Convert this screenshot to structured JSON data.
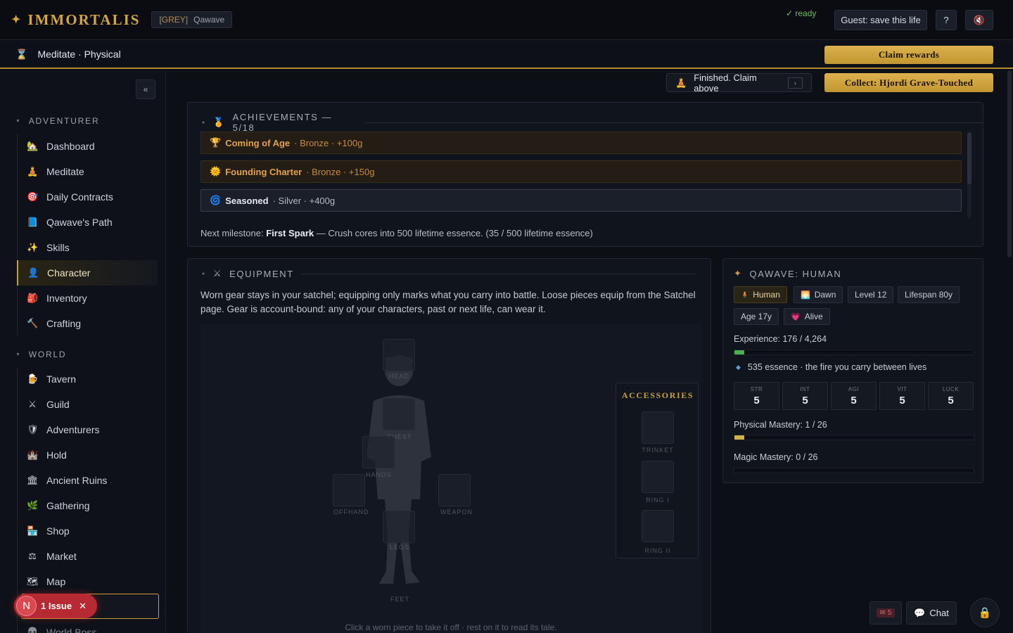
{
  "app": {
    "title": "IMMORTALIS",
    "grey_tag": "[GREY]",
    "user": "Qawave"
  },
  "topbar": {
    "save_label": "Guest: save this life",
    "help_label": "?",
    "mute_icon": "speaker-muted-icon"
  },
  "activity": {
    "label": "Meditate · Physical",
    "status": "✓ ready",
    "claim_label": "Claim rewards",
    "finished_label": "Finished. Claim above",
    "finished_mini": "›",
    "collect_label": "Collect: Hjordi Grave-Touched"
  },
  "sidebar": {
    "collapse_label": "«",
    "sections": [
      {
        "title": "ADVENTURER",
        "items": [
          {
            "label": "Dashboard",
            "icon": "🏡"
          },
          {
            "label": "Meditate",
            "icon": "🧘"
          },
          {
            "label": "Daily Contracts",
            "icon": "🎯"
          },
          {
            "label": "Qawave's Path",
            "icon": "📘"
          },
          {
            "label": "Skills",
            "icon": "✨"
          },
          {
            "label": "Character",
            "icon": "👤"
          },
          {
            "label": "Inventory",
            "icon": "🎒"
          },
          {
            "label": "Crafting",
            "icon": "🔨"
          }
        ]
      },
      {
        "title": "WORLD",
        "items": [
          {
            "label": "Tavern",
            "icon": "🍺"
          },
          {
            "label": "Guild",
            "icon": "⚔"
          },
          {
            "label": "Adventurers",
            "icon": "🛡"
          },
          {
            "label": "Hold",
            "icon": "🏰"
          },
          {
            "label": "Ancient Ruins",
            "icon": "🏛"
          },
          {
            "label": "Gathering",
            "icon": "🌿"
          },
          {
            "label": "Shop",
            "icon": "🏪"
          },
          {
            "label": "Market",
            "icon": "⚖"
          },
          {
            "label": "Map",
            "icon": "🗺"
          },
          {
            "label": "",
            "icon": ""
          },
          {
            "label": "World Boss",
            "icon": "💀"
          }
        ]
      }
    ],
    "issue": {
      "avatar": "N",
      "label": "1 Issue",
      "close": "✕"
    }
  },
  "achievements": {
    "title": "ACHIEVEMENTS — 5/18",
    "items": [
      {
        "icon": "🏆",
        "name": "Coming of Age",
        "detail": "· Bronze · +100g",
        "tier": "bronze"
      },
      {
        "icon": "🌞",
        "name": "Founding Charter",
        "detail": "· Bronze · +150g",
        "tier": "bronze"
      },
      {
        "icon": "🌀",
        "name": "Seasoned",
        "detail": "· Silver · +400g",
        "tier": "silver"
      }
    ],
    "milestone_prefix": "Next milestone:",
    "milestone_name": "First Spark",
    "milestone_text": "— Crush cores into 500 lifetime essence. (35 / 500 lifetime essence)"
  },
  "equipment": {
    "title": "EQUIPMENT",
    "description": "Worn gear stays in your satchel; equipping only marks what you carry into battle. Loose pieces equip from the Satchel page. Gear is account-bound: any of your characters, past or next life, can wear it.",
    "slots": {
      "head": "HEAD",
      "chest": "CHEST",
      "hands": "HANDS",
      "offhand": "OFFHAND",
      "weapon": "WEAPON",
      "legs": "LEGS",
      "feet": "FEET"
    },
    "accessories": {
      "title": "ACCESSORIES",
      "trinket": "TRINKET",
      "ring1": "RING I",
      "ring2": "RING II"
    },
    "hint": "Click a worn piece to take it off · rest on it to read its tale."
  },
  "character": {
    "title": "QAWAVE: HUMAN",
    "tags": {
      "race": "Human",
      "time": "Dawn",
      "level": "Level 12",
      "lifespan": "Lifespan 80y",
      "age": "Age 17y",
      "status": "Alive"
    },
    "experience_label": "Experience: 176 / 4,264",
    "experience_fraction": 0.041,
    "essence": "535 essence · the fire you carry between lives",
    "stats": [
      {
        "k": "STR",
        "v": "5"
      },
      {
        "k": "INT",
        "v": "5"
      },
      {
        "k": "AGI",
        "v": "5"
      },
      {
        "k": "VIT",
        "v": "5"
      },
      {
        "k": "LUCK",
        "v": "5"
      }
    ],
    "physical_label": "Physical Mastery: 1 / 26",
    "physical_fraction": 0.038,
    "magic_label": "Magic Mastery: 0 / 26",
    "magic_fraction": 0
  },
  "footer": {
    "mail_count": "✉ 5",
    "chat_label": "Chat"
  },
  "colors": {
    "gold": "#c9a03c",
    "xp": "#4caf50",
    "mastery": "#d4b24a"
  }
}
